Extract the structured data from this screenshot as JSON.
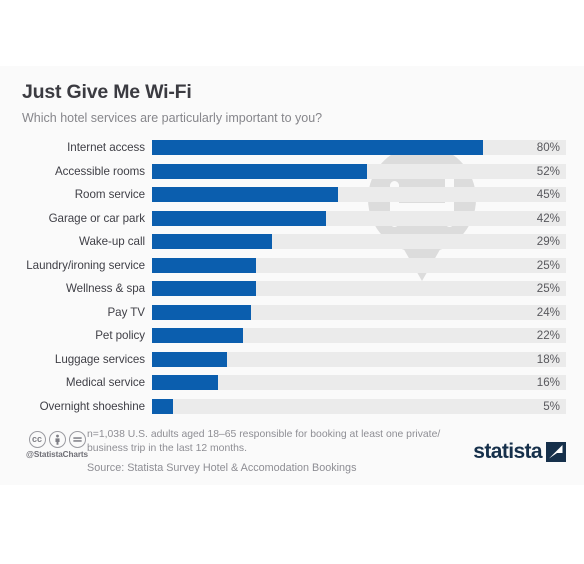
{
  "header": {
    "title": "Just Give Me Wi-Fi",
    "subtitle": "Which hotel services are particularly important to you?"
  },
  "footer": {
    "cc_badges": [
      "cc",
      "BY",
      "ND"
    ],
    "handle": "@StatistaCharts",
    "note": "n=1,038 U.S. adults aged 18–65 responsible for booking at least one private/ business trip in the last 12 months.",
    "source": "Source: Statista Survey Hotel & Accomodation Bookings",
    "logo_text": "statista"
  },
  "colors": {
    "bar": "#0b5eae",
    "track": "#ebebeb",
    "card_bg": "#fafafa",
    "title": "#3b3b41",
    "subtitle": "#86868b",
    "label": "#3f3f46",
    "value": "#58585d",
    "logo": "#16304b",
    "watermark": "#dcdcdc"
  },
  "watermark": {
    "icon": "hotel-bed-map-pin-icon"
  },
  "chart_data": {
    "type": "bar",
    "orientation": "horizontal",
    "title": "Just Give Me Wi-Fi",
    "subtitle": "Which hotel services are particularly important to you?",
    "xlabel": "",
    "ylabel": "",
    "xlim": [
      0,
      100
    ],
    "grid": false,
    "legend": false,
    "unit": "%",
    "categories": [
      "Internet access",
      "Accessible rooms",
      "Room service",
      "Garage or car park",
      "Wake-up call",
      "Laundry/ironing service",
      "Wellness & spa",
      "Pay TV",
      "Pet policy",
      "Luggage services",
      "Medical service",
      "Overnight shoeshine"
    ],
    "values": [
      80,
      52,
      45,
      42,
      29,
      25,
      25,
      24,
      22,
      18,
      16,
      5
    ],
    "value_labels": [
      "80%",
      "52%",
      "45%",
      "42%",
      "29%",
      "25%",
      "25%",
      "24%",
      "22%",
      "18%",
      "16%",
      "5%"
    ]
  }
}
